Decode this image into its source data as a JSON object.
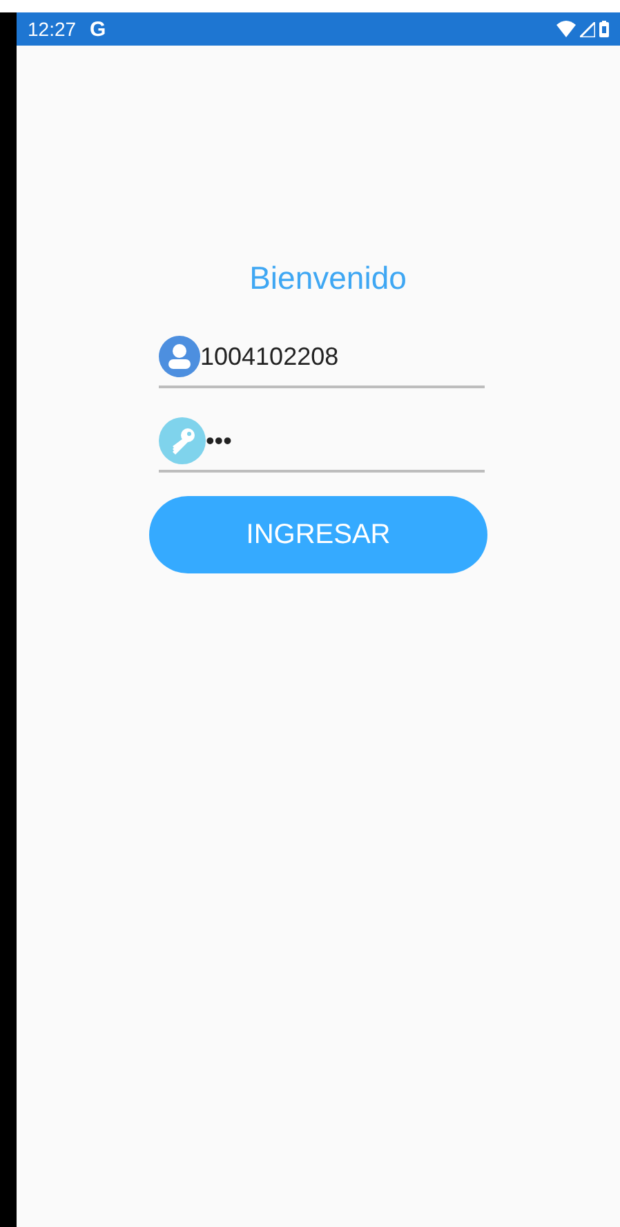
{
  "status_bar": {
    "time": "12:27",
    "app_letter": "G"
  },
  "title": "Bienvenido",
  "fields": [
    {
      "kind": "user",
      "value": "1004102208"
    },
    {
      "kind": "password",
      "value": "•••"
    }
  ],
  "button": {
    "label": "INGRESAR"
  }
}
